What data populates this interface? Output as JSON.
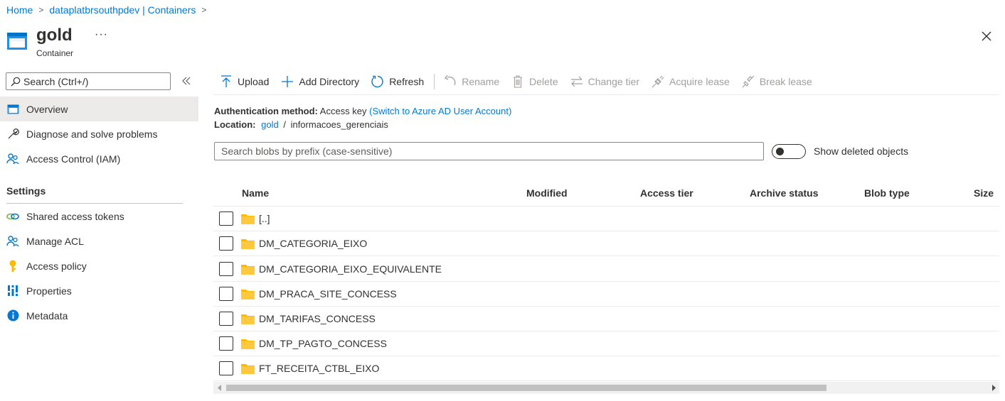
{
  "breadcrumb": {
    "home": "Home",
    "account": "dataplatbrsouthpdev | Containers"
  },
  "header": {
    "title": "gold",
    "subtitle": "Container",
    "more": "···"
  },
  "nav": {
    "search_placeholder": "Search (Ctrl+/)",
    "items": [
      {
        "label": "Overview"
      },
      {
        "label": "Diagnose and solve problems"
      },
      {
        "label": "Access Control (IAM)"
      }
    ],
    "settings_heading": "Settings",
    "settings_items": [
      {
        "label": "Shared access tokens"
      },
      {
        "label": "Manage ACL"
      },
      {
        "label": "Access policy"
      },
      {
        "label": "Properties"
      },
      {
        "label": "Metadata"
      }
    ]
  },
  "toolbar": {
    "upload": "Upload",
    "add_directory": "Add Directory",
    "refresh": "Refresh",
    "rename": "Rename",
    "delete": "Delete",
    "change_tier": "Change tier",
    "acquire_lease": "Acquire lease",
    "break_lease": "Break lease"
  },
  "info": {
    "auth_label": "Authentication method:",
    "auth_value": "Access key",
    "auth_switch": "(Switch to Azure AD User Account)",
    "location_label": "Location:",
    "location_root": "gold",
    "location_sep": "/",
    "location_path": "informacoes_gerenciais"
  },
  "blob_search": {
    "placeholder": "Search blobs by prefix (case-sensitive)"
  },
  "show_deleted": {
    "label": "Show deleted objects",
    "on": false
  },
  "table": {
    "columns": [
      "Name",
      "Modified",
      "Access tier",
      "Archive status",
      "Blob type",
      "Size"
    ],
    "rows": [
      {
        "name": "[..]"
      },
      {
        "name": "DM_CATEGORIA_EIXO"
      },
      {
        "name": "DM_CATEGORIA_EIXO_EQUIVALENTE"
      },
      {
        "name": "DM_PRACA_SITE_CONCESS"
      },
      {
        "name": "DM_TARIFAS_CONCESS"
      },
      {
        "name": "DM_TP_PAGTO_CONCESS"
      },
      {
        "name": "FT_RECEITA_CTBL_EIXO"
      }
    ]
  },
  "colors": {
    "accent": "#0078d4",
    "folder": "#ffb900",
    "selected_nav": "#edebe9"
  }
}
